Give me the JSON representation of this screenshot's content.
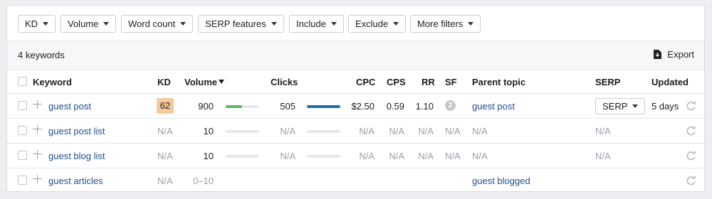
{
  "filters": [
    {
      "label": "KD"
    },
    {
      "label": "Volume"
    },
    {
      "label": "Word count"
    },
    {
      "label": "SERP features"
    },
    {
      "label": "Include"
    },
    {
      "label": "Exclude"
    },
    {
      "label": "More filters"
    }
  ],
  "summary": {
    "count_text": "4 keywords",
    "export_label": "Export"
  },
  "columns": {
    "keyword": "Keyword",
    "kd": "KD",
    "volume": "Volume",
    "clicks": "Clicks",
    "cpc": "CPC",
    "cps": "CPS",
    "rr": "RR",
    "sf": "SF",
    "parent_topic": "Parent topic",
    "serp": "SERP",
    "updated": "Updated"
  },
  "rows": [
    {
      "keyword": "guest post",
      "kd": "62",
      "volume": "900",
      "volume_level": 0.48,
      "clicks": "505",
      "clicks_level": 1.0,
      "cpc": "$2.50",
      "cps": "0.59",
      "rr": "1.10",
      "sf": "2",
      "parent_topic": "guest post",
      "serp": "SERP",
      "updated": "5 days"
    },
    {
      "keyword": "guest post list",
      "kd": "N/A",
      "volume": "10",
      "volume_level": 0,
      "clicks": "N/A",
      "clicks_level": 0,
      "cpc": "N/A",
      "cps": "N/A",
      "rr": "N/A",
      "sf": "N/A",
      "parent_topic": "N/A",
      "serp": "N/A",
      "updated": ""
    },
    {
      "keyword": "guest blog list",
      "kd": "N/A",
      "volume": "10",
      "volume_level": 0,
      "clicks": "N/A",
      "clicks_level": 0,
      "cpc": "N/A",
      "cps": "N/A",
      "rr": "N/A",
      "sf": "N/A",
      "parent_topic": "N/A",
      "serp": "N/A",
      "updated": ""
    },
    {
      "keyword": "guest articles",
      "kd": "N/A",
      "volume": "0–10",
      "volume_level": 0,
      "clicks": "",
      "clicks_level": 0,
      "cpc": "",
      "cps": "",
      "rr": "",
      "sf": "",
      "parent_topic": "guest blogged",
      "serp": "",
      "updated": ""
    }
  ],
  "colors": {
    "kd_badge": "#f6c99a",
    "volume_fill": "#5cb85c",
    "clicks_fill": "#1f6fa8",
    "link": "#1f4e8c",
    "na": "#9aa0a6"
  },
  "icons": {
    "export": "download-icon",
    "refresh": "refresh-icon",
    "add": "plus-icon"
  }
}
